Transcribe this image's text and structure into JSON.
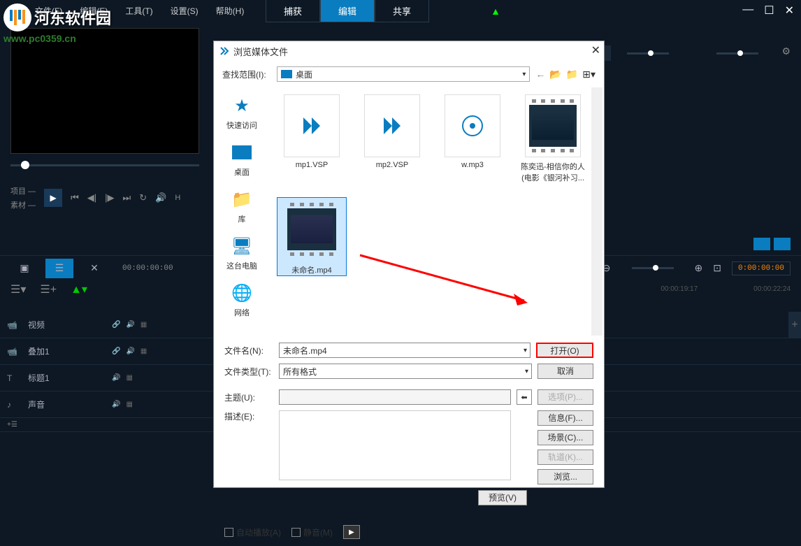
{
  "watermark": {
    "text": "河东软件园",
    "url": "www.pc0359.cn"
  },
  "menubar": {
    "items": [
      "文件(F)",
      "编辑(E)",
      "工具(T)",
      "设置(S)",
      "帮助(H)"
    ]
  },
  "top_tabs": {
    "capture": "捕获",
    "edit": "编辑",
    "share": "共享"
  },
  "preview": {
    "label_project": "项目",
    "label_material": "素材"
  },
  "timeline": {
    "time_start": "00:00:00:00",
    "time_right1": "00:00:19:17",
    "time_right2": "00:00:22:24",
    "time_box": "0:00:00:00",
    "tracks": [
      {
        "label": "视频",
        "icon": "video"
      },
      {
        "label": "叠加1",
        "icon": "video"
      },
      {
        "label": "标题1",
        "icon": "text"
      },
      {
        "label": "声音",
        "icon": "audio"
      }
    ]
  },
  "dialog": {
    "title": "浏览媒体文件",
    "lookup_label": "查找范围(I):",
    "lookup_value": "桌面",
    "sidebar": [
      {
        "label": "快速访问",
        "icon": "star"
      },
      {
        "label": "桌面",
        "icon": "desktop"
      },
      {
        "label": "库",
        "icon": "folder"
      },
      {
        "label": "这台电脑",
        "icon": "computer"
      },
      {
        "label": "网络",
        "icon": "network"
      }
    ],
    "files": [
      {
        "name": "mp1.VSP",
        "type": "vsp"
      },
      {
        "name": "mp2.VSP",
        "type": "vsp"
      },
      {
        "name": "w.mp3",
        "type": "audio"
      },
      {
        "name": "陈奕迅-相信你的人(电影《银河补习...",
        "type": "video"
      },
      {
        "name": "未命名.mp4",
        "type": "video-sel"
      }
    ],
    "filename_label": "文件名(N):",
    "filename_value": "未命名.mp4",
    "filetype_label": "文件类型(T):",
    "filetype_value": "所有格式",
    "open_btn": "打开(O)",
    "cancel_btn": "取消",
    "subject_label": "主题(U):",
    "desc_label": "描述(E):",
    "options_btn": "选项(P)...",
    "info_btn": "信息(F)...",
    "scene_btn": "场景(C)...",
    "track_btn": "轨道(K)...",
    "browse_btn": "浏览...",
    "preview_btn": "预览(V)",
    "autoplay": "自动播放(A)",
    "mute": "静音(M)"
  }
}
